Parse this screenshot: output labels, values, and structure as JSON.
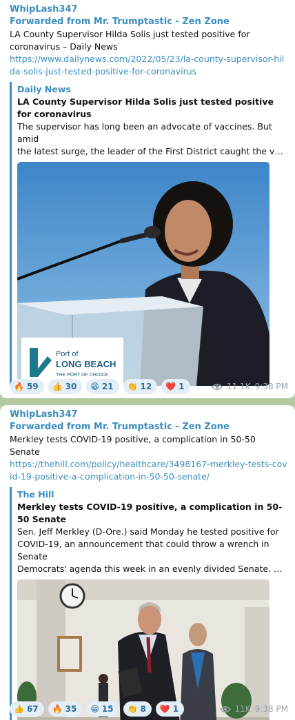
{
  "posts": [
    {
      "author": "WhipLash347",
      "forwarded": "Forwarded from Mr. Trumptastic - Zen Zone",
      "text": "LA County Supervisor Hilda Solis just tested positive for coronavirus – Daily News",
      "link": "https://www.dailynews.com/2022/05/23/la-county-supervisor-hilda-solis-just-tested-positive-for-coronavirus",
      "preview": {
        "site": "Daily News",
        "title": "LA County Supervisor Hilda Solis just tested positive for coronavirus",
        "desc_line1": "The supervisor has long been an advocate of vaccines. But amid",
        "desc_line2": "the latest surge, the leader of the First District caught the virus, s...",
        "image_sign_line1": "Port of",
        "image_sign_line2": "LONG BEACH",
        "image_sign_line3": "THE PORT OF CHOICE"
      },
      "reactions": [
        {
          "emoji": "🔥",
          "icon": "fire-icon",
          "count": "59"
        },
        {
          "emoji": "👍",
          "icon": "thumbs-up-icon",
          "count": "30"
        },
        {
          "emoji": "😁",
          "icon": "grin-icon",
          "count": "21"
        },
        {
          "emoji": "👏",
          "icon": "clap-icon",
          "count": "12"
        },
        {
          "emoji": "❤️",
          "icon": "heart-icon",
          "count": "1"
        }
      ],
      "views": "11.1K",
      "time": "9:38 PM"
    },
    {
      "author": "WhipLash347",
      "forwarded": "Forwarded from Mr. Trumptastic - Zen Zone",
      "text": "Merkley tests COVID-19 positive, a complication in 50-50 Senate",
      "link": "https://thehill.com/policy/healthcare/3498167-merkley-tests-covid-19-positive-a-complication-in-50-50-senate/",
      "preview": {
        "site": "The Hill",
        "title": "Merkley tests COVID-19 positive, a complication in 50-50 Senate",
        "desc_line1": "Sen. Jeff Merkley (D-Ore.) said Monday he tested positive for",
        "desc_line2": "COVID-19, an announcement that could throw a wrench in Senate",
        "desc_line3": "Democrats' agenda this week in an evenly divided Senate. Majori..."
      },
      "reactions": [
        {
          "emoji": "👍",
          "icon": "thumbs-up-icon",
          "count": "67"
        },
        {
          "emoji": "🔥",
          "icon": "fire-icon",
          "count": "35"
        },
        {
          "emoji": "😁",
          "icon": "grin-icon",
          "count": "15"
        },
        {
          "emoji": "👏",
          "icon": "clap-icon",
          "count": "8"
        },
        {
          "emoji": "❤️",
          "icon": "heart-icon",
          "count": "1"
        }
      ],
      "views": "11K",
      "time": "9:38 PM"
    }
  ],
  "colors": {
    "accent": "#3a8ec0",
    "chat_background": "#b9cfa9",
    "reaction_bg": "#e4eef6",
    "meta_text": "#9aa4ad"
  }
}
